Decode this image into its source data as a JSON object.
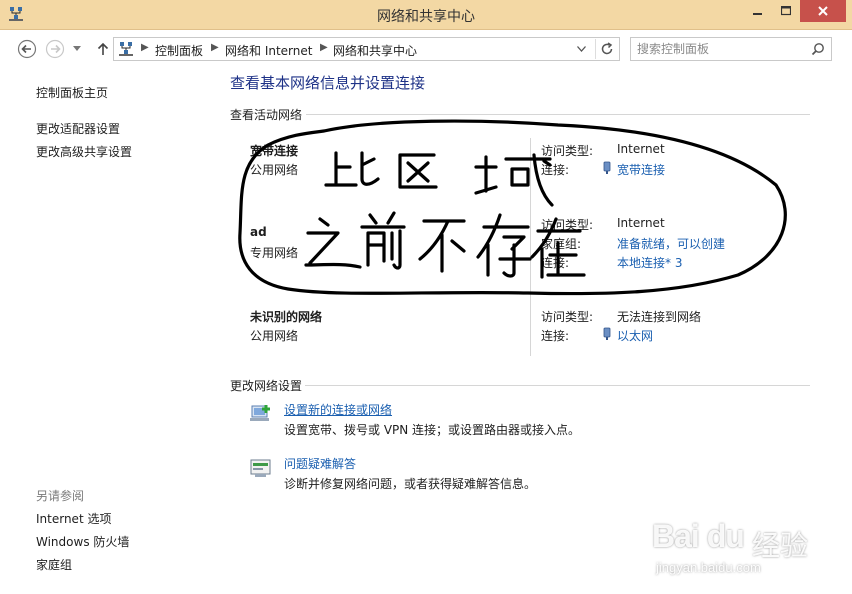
{
  "window": {
    "title": "网络和共享中心",
    "colors": {
      "titlebar": "#f3d8a4",
      "close_button": "#c7514b",
      "link": "#1a5fb0",
      "heading": "#1e3287"
    }
  },
  "address_bar": {
    "breadcrumbs": [
      "控制面板",
      "网络和 Internet",
      "网络和共享中心"
    ],
    "search_placeholder": "搜索控制面板"
  },
  "sidebar": {
    "links": [
      "控制面板主页",
      "更改适配器设置",
      "更改高级共享设置"
    ],
    "see_also_label": "另请参阅",
    "see_also_links": [
      "Internet 选项",
      "Windows 防火墙",
      "家庭组"
    ]
  },
  "main": {
    "page_title": "查看基本网络信息并设置连接",
    "active_networks_heading": "查看活动网络",
    "networks": [
      {
        "name": "宽带连接",
        "category": "公用网络",
        "access_type_label": "访问类型:",
        "access_type": "Internet",
        "connection_label": "连接:",
        "connection": "宽带连接"
      },
      {
        "name": "ad",
        "category": "专用网络",
        "access_type_label": "访问类型:",
        "access_type": "Internet",
        "homegroup_label": "家庭组:",
        "homegroup": "准备就绪，可以创建",
        "connection_label": "连接:",
        "connection": "本地连接* 3"
      },
      {
        "name": "未识别的网络",
        "category": "公用网络",
        "access_type_label": "访问类型:",
        "access_type": "无法连接到网络",
        "connection_label": "连接:",
        "connection": "以太网"
      }
    ],
    "change_settings_heading": "更改网络设置",
    "tasks": [
      {
        "link": "设置新的连接或网络",
        "description": "设置宽带、拨号或 VPN 连接；或设置路由器或接入点。",
        "icon": "new-connection-icon"
      },
      {
        "link": "问题疑难解答",
        "description": "诊断并修复网络问题，或者获得疑难解答信息。",
        "icon": "troubleshoot-icon"
      }
    ]
  },
  "annotation": {
    "handwritten_text": "此区域之前不存在"
  },
  "watermark": {
    "brand": "Bai du",
    "brand_cn": "经验",
    "url": "jingyan.baidu.com"
  }
}
